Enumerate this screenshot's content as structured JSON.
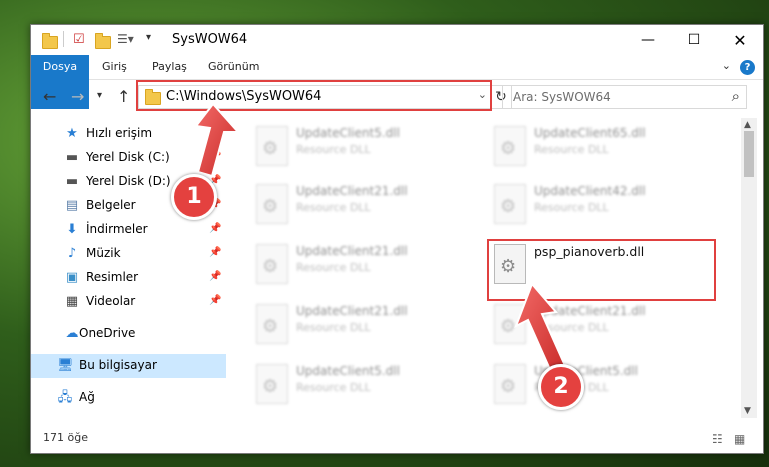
{
  "window": {
    "title": "SysWOW64"
  },
  "ribbon": {
    "tabs": [
      "Dosya",
      "Giriş",
      "Paylaş",
      "Görünüm"
    ]
  },
  "address": {
    "path": "C:\\Windows\\SysWOW64"
  },
  "search": {
    "placeholder": "Ara: SysWOW64"
  },
  "sidebar": {
    "items": [
      {
        "label": "Hızlı erişim",
        "icon": "star-icon"
      },
      {
        "label": "Yerel Disk (C:)",
        "icon": "drive-icon"
      },
      {
        "label": "Yerel Disk (D:)",
        "icon": "drive-icon"
      },
      {
        "label": "Belgeler",
        "icon": "documents-icon"
      },
      {
        "label": "İndirmeler",
        "icon": "download-icon"
      },
      {
        "label": "Müzik",
        "icon": "music-icon"
      },
      {
        "label": "Resimler",
        "icon": "pictures-icon"
      },
      {
        "label": "Videolar",
        "icon": "videos-icon"
      },
      {
        "label": "OneDrive",
        "icon": "cloud-icon"
      },
      {
        "label": "Bu bilgisayar",
        "icon": "computer-icon"
      },
      {
        "label": "Ağ",
        "icon": "network-icon"
      }
    ]
  },
  "files": [
    {
      "name": "UpdateClient5.dll",
      "desc": "Resource DLL"
    },
    {
      "name": "UpdateClient65.dll",
      "desc": "Resource DLL"
    },
    {
      "name": "UpdateClient21.dll",
      "desc": "Resource DLL"
    },
    {
      "name": "UpdateClient42.dll",
      "desc": "Resource DLL"
    },
    {
      "name": "UpdateClient21.dll",
      "desc": "Resource DLL"
    },
    {
      "name": "psp_pianoverb.dll",
      "desc": ""
    },
    {
      "name": "UpdateClient21.dll",
      "desc": "Resource DLL"
    },
    {
      "name": "UpdateClient21.dll",
      "desc": "Resource DLL"
    },
    {
      "name": "UpdateClient5.dll",
      "desc": "Resource DLL"
    },
    {
      "name": "UpdateClient5.dll",
      "desc": "Resource DLL"
    }
  ],
  "status": {
    "count": "171 öğe"
  },
  "annotations": {
    "badge1": "1",
    "badge2": "2"
  },
  "colors": {
    "accent": "#1979ca",
    "highlight": "#e0403f",
    "selection": "#cce8ff"
  }
}
